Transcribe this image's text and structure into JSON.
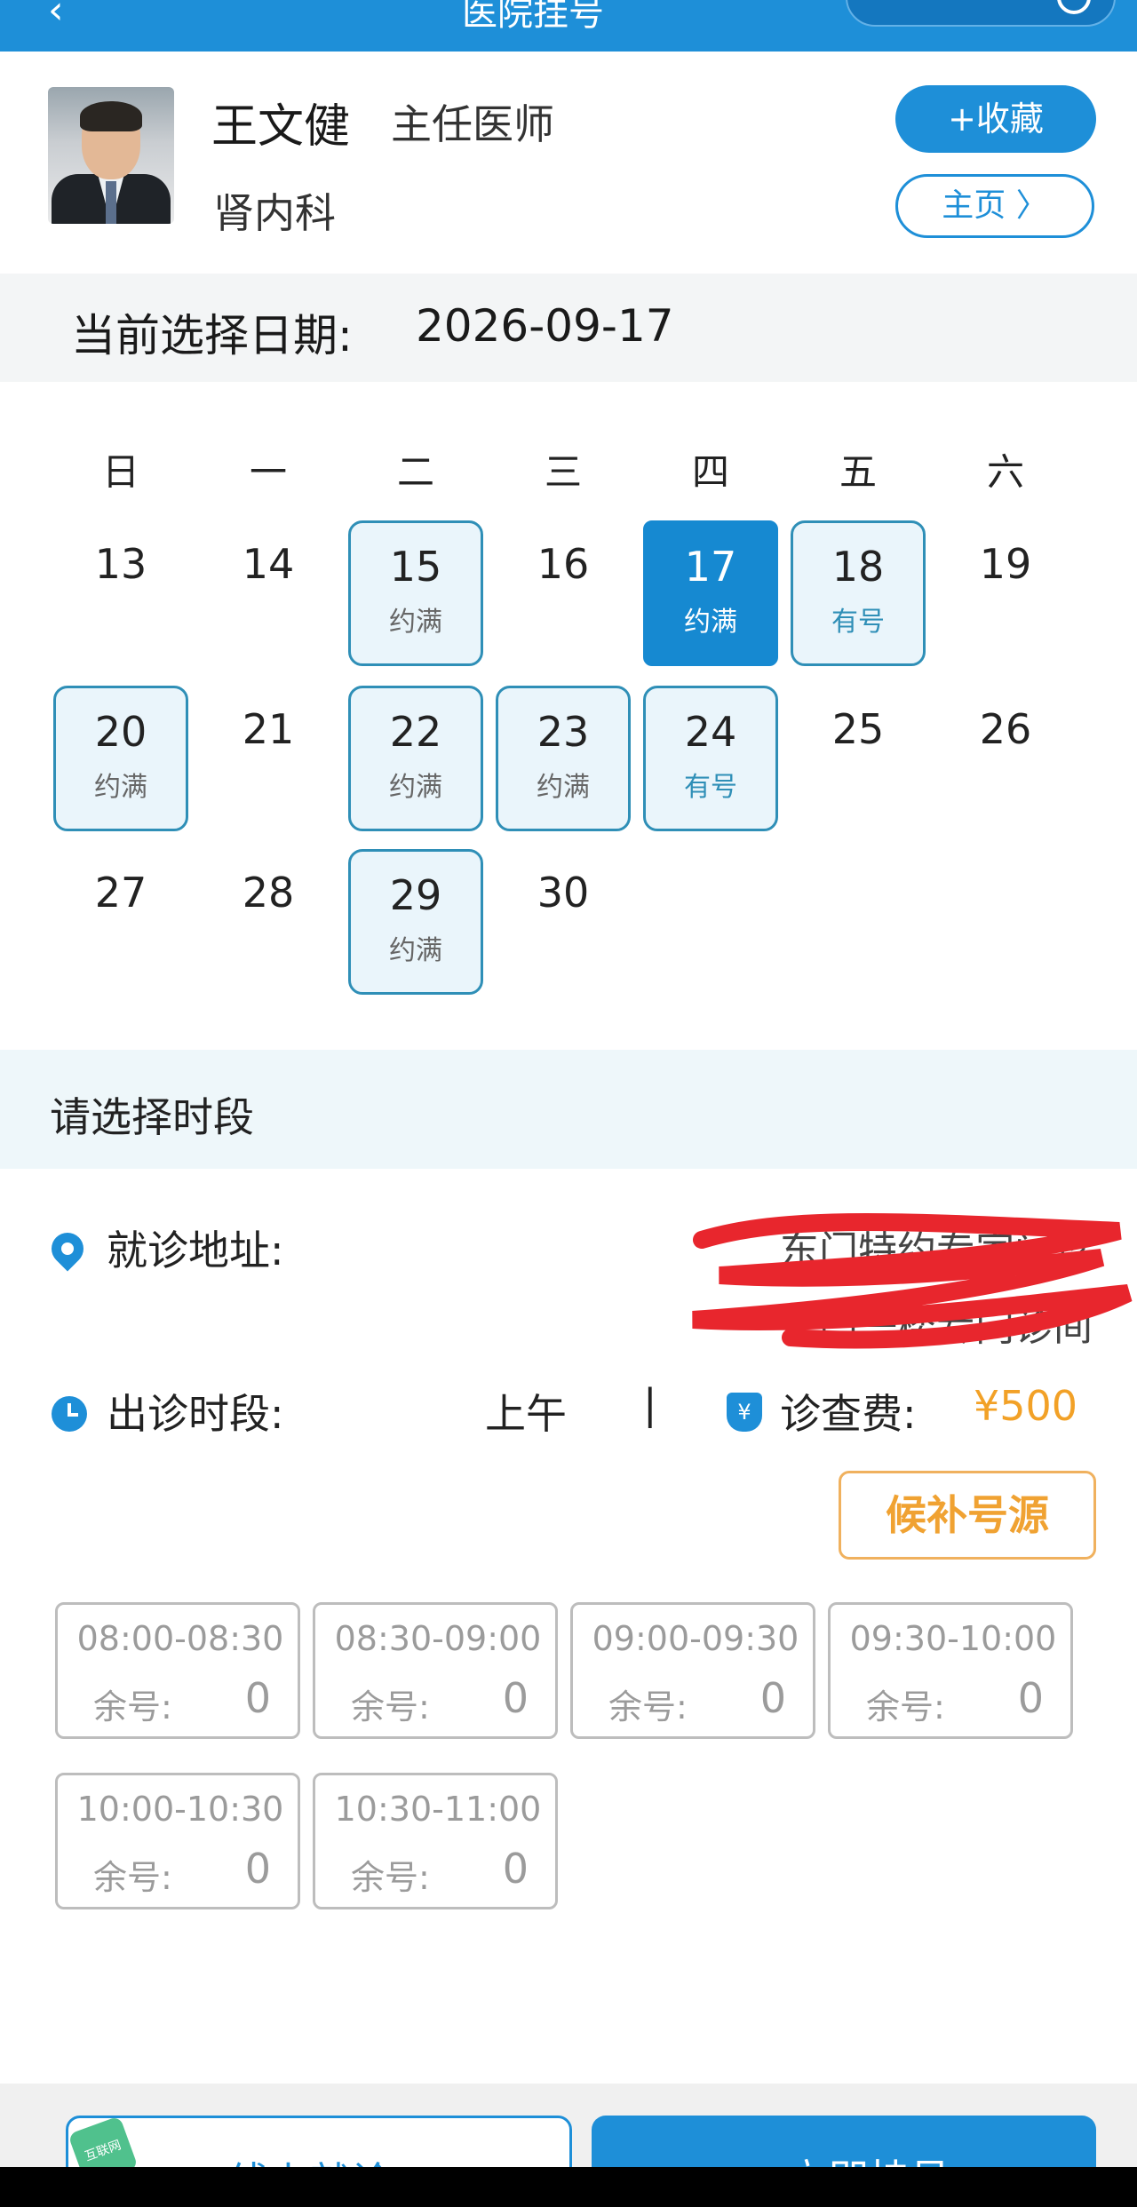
{
  "topbar": {
    "back_glyph": "‹",
    "title": "医院挂号",
    "menu_icon": "more-dots-icon",
    "close_icon": "close-circle-icon"
  },
  "doctor": {
    "name": "王文健",
    "title": "主任医师",
    "department": "肾内科",
    "favorite_label": "+收藏",
    "home_label": "主页 〉"
  },
  "selected_date": {
    "label": "当前选择日期:",
    "value": "2026-09-17"
  },
  "calendar": {
    "weekdays": [
      "日",
      "一",
      "二",
      "三",
      "四",
      "五",
      "六"
    ],
    "weeks": [
      [
        {
          "day": "13",
          "status": ""
        },
        {
          "day": "14",
          "status": ""
        },
        {
          "day": "15",
          "status": "约满"
        },
        {
          "day": "16",
          "status": ""
        },
        {
          "day": "17",
          "status": "约满"
        },
        {
          "day": "18",
          "status": "有号"
        },
        {
          "day": "19",
          "status": ""
        }
      ],
      [
        {
          "day": "20",
          "status": "约满"
        },
        {
          "day": "21",
          "status": ""
        },
        {
          "day": "22",
          "status": "约满"
        },
        {
          "day": "23",
          "status": "约满"
        },
        {
          "day": "24",
          "status": "有号"
        },
        {
          "day": "25",
          "status": ""
        },
        {
          "day": "26",
          "status": ""
        }
      ],
      [
        {
          "day": "27",
          "status": ""
        },
        {
          "day": "28",
          "status": ""
        },
        {
          "day": "29",
          "status": "约满"
        },
        {
          "day": "30",
          "status": ""
        }
      ]
    ]
  },
  "period_section": {
    "title": "请选择时段"
  },
  "info": {
    "address_label": "就诊地址:",
    "address_lines": [
      "东门特约专家门诊",
      "东门一楼专门诊间"
    ],
    "time_label": "出诊时段:",
    "time_value": "上午",
    "separator": "|",
    "fee_label": "诊查费:",
    "fee_value": "¥500",
    "waitlist_label": "候补号源"
  },
  "slots": [
    {
      "time": "08:00-08:30",
      "remain_label": "余号:",
      "remain": "0"
    },
    {
      "time": "08:30-09:00",
      "remain_label": "余号:",
      "remain": "0"
    },
    {
      "time": "09:00-09:30",
      "remain_label": "余号:",
      "remain": "0"
    },
    {
      "time": "09:30-10:00",
      "remain_label": "余号:",
      "remain": "0"
    },
    {
      "time": "10:00-10:30",
      "remain_label": "余号:",
      "remain": "0"
    },
    {
      "time": "10:30-11:00",
      "remain_label": "余号:",
      "remain": "0"
    }
  ],
  "bottom": {
    "badge": "互联网",
    "left_label": "线上就诊",
    "right_label": "立即挂号"
  },
  "colors": {
    "primary": "#1e8fd8",
    "fee": "#f2a127",
    "waitlist_border": "#f0b15e",
    "calendar_box": "#eaf5fb"
  }
}
